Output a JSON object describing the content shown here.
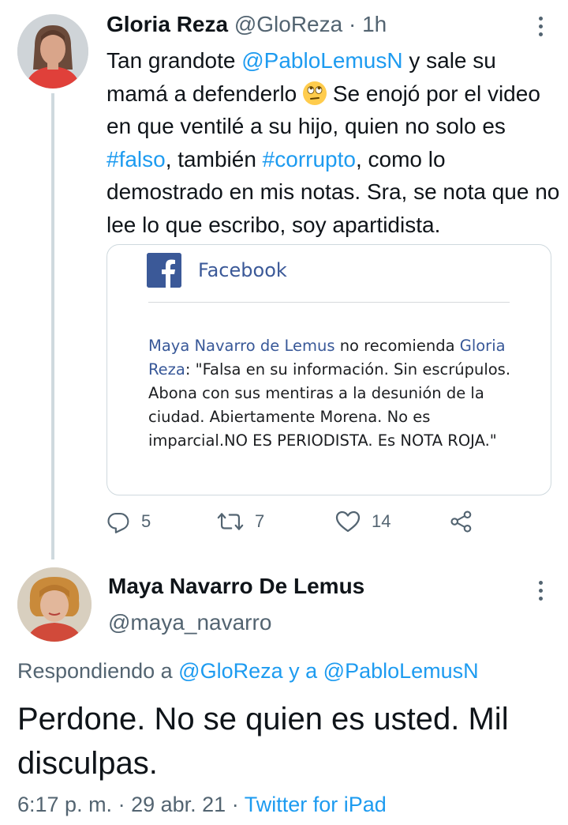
{
  "tweet": {
    "author_name": "Gloria Reza",
    "author_handle": "@GloReza",
    "separator": "·",
    "time_ago": "1h",
    "text_parts": {
      "p1": "Tan grandote ",
      "mention": "@PabloLemusN",
      "p2": " y sale su mamá a defenderlo ",
      "p3": " Se enojó por el video en que ventilé a su hijo, quien no solo es ",
      "hashtag1": "#falso",
      "p4": ", también ",
      "hashtag2": "#corrupto",
      "p5": ", como lo demostrado en mis notas. Sra, se nota que no lee lo que escribo, soy apartidista."
    },
    "emoji_icon": "face-with-rolling-eyes-emoji",
    "quote_card": {
      "source_title": "Facebook",
      "author_link": "Maya Navarro de Lemus",
      "verb": " no recomienda ",
      "target_link": "Gloria Reza",
      "review": ": \"Falsa en su información. Sin escrúpulos. Abona con sus mentiras a la desunión de la ciudad. Abiertamente Morena. No es imparcial.NO ES PERIODISTA. Es NOTA ROJA.\""
    },
    "actions": {
      "replies": "5",
      "retweets": "7",
      "likes": "14"
    }
  },
  "reply": {
    "author_name": "Maya Navarro De Lemus",
    "author_handle": "@maya_navarro",
    "replying_label": "Respondiendo a ",
    "replying_to_1": "@GloReza",
    "replying_and": " y a ",
    "replying_to_2": "@PabloLemusN",
    "text": "Perdone. No se quien es usted. Mil disculpas.",
    "time": "6:17 p. m.",
    "date": "29 abr. 21",
    "separator": " · ",
    "client": "Twitter for iPad"
  },
  "colors": {
    "link_blue": "#1d9bf0",
    "secondary_text": "#536471",
    "facebook_blue": "#3b5998",
    "border": "#cfd9de"
  },
  "icons": [
    "more-vertical-icon",
    "reply-icon",
    "retweet-icon",
    "like-icon",
    "share-icon",
    "facebook-logo-icon"
  ]
}
